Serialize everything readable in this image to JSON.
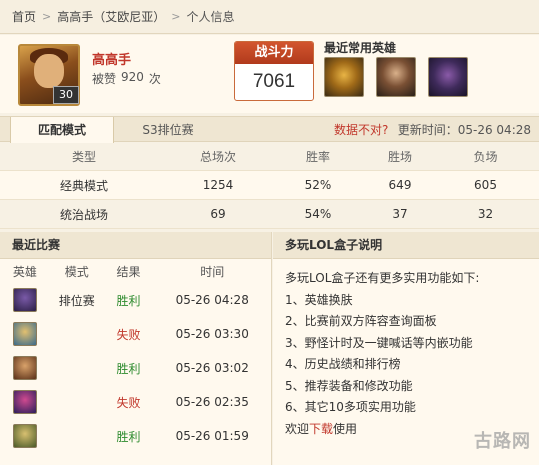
{
  "breadcrumb": {
    "items": [
      "首页",
      "高高手（艾欧尼亚）",
      "个人信息"
    ],
    "separator": ">"
  },
  "profile": {
    "name": "高高手",
    "likes_label": "被赞",
    "likes_count": "920",
    "likes_unit": "次",
    "level": "30",
    "power_label": "战斗力",
    "power_value": "7061",
    "recent_heroes_title": "最近常用英雄"
  },
  "stats_tabs": {
    "tabs": [
      "匹配模式",
      "S3排位赛"
    ],
    "active": "匹配模式",
    "data_wrong": "数据不对?",
    "update_label": "更新时间：",
    "update_time": "05-26 04:28"
  },
  "stats_table": {
    "headers": [
      "类型",
      "总场次",
      "胜率",
      "胜场",
      "负场"
    ],
    "rows": [
      [
        "经典模式",
        "1254",
        "52%",
        "649",
        "605"
      ],
      [
        "统治战场",
        "69",
        "54%",
        "37",
        "32"
      ]
    ]
  },
  "recent_matches": {
    "title": "最近比赛",
    "headers": [
      "英雄",
      "模式",
      "结果",
      "时间"
    ],
    "rows": [
      {
        "hero_icon": "purple-hero-icon",
        "mode": "排位赛",
        "result": "胜利",
        "result_type": "win",
        "time": "05-26 04:28"
      },
      {
        "hero_icon": "yellow-hero-icon",
        "mode": "",
        "result": "失败",
        "result_type": "loss",
        "time": "05-26 03:30"
      },
      {
        "hero_icon": "brown-hero-icon",
        "mode": "",
        "result": "胜利",
        "result_type": "win",
        "time": "05-26 03:02"
      },
      {
        "hero_icon": "pink-hero-icon",
        "mode": "",
        "result": "失败",
        "result_type": "loss",
        "time": "05-26 02:35"
      },
      {
        "hero_icon": "green-hero-icon",
        "mode": "",
        "result": "胜利",
        "result_type": "win",
        "time": "05-26 01:59"
      }
    ]
  },
  "help": {
    "title": "多玩LOL盒子说明",
    "intro": "多玩LOL盒子还有更多实用功能如下:",
    "items": [
      "1、英雄换肤",
      "2、比赛前双方阵容查询面板",
      "3、野怪计时及一键喊话等内嵌功能",
      "4、历史战绩和排行榜",
      "5、推荐装备和修改功能",
      "6、其它10多项实用功能"
    ],
    "welcome": "欢迎",
    "download": "下载",
    "use": "使用"
  },
  "watermark": "古路网",
  "colors": {
    "accent_red": "#c1372b",
    "win_green": "#2e8b2e",
    "background": "#f7f1e4"
  }
}
